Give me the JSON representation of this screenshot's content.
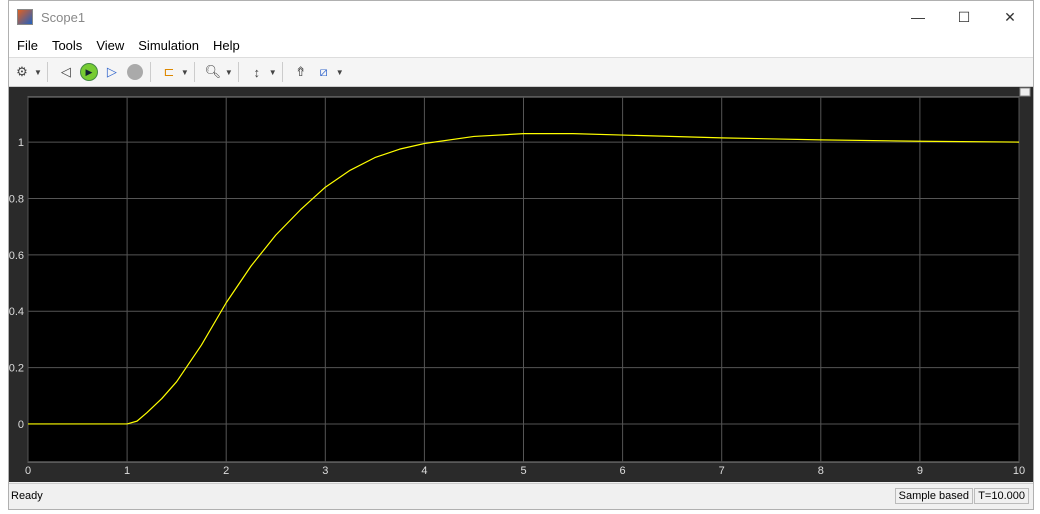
{
  "window": {
    "title": "Scope1",
    "minimize": "—",
    "maximize": "☐",
    "close": "✕"
  },
  "menu": [
    "File",
    "Tools",
    "View",
    "Simulation",
    "Help"
  ],
  "toolbar": {
    "icons": [
      "gear-icon",
      "step-back-icon",
      "run-icon",
      "step-forward-icon",
      "stop-icon",
      "signal-selector-icon",
      "zoom-icon",
      "scale-axes-icon",
      "triggers-icon",
      "measurements-icon"
    ]
  },
  "status": {
    "left": "Ready",
    "mode": "Sample based",
    "time": "T=10.000"
  },
  "colors": {
    "trace": "#ffff00",
    "axes_bg": "#000000",
    "grid": "#555555"
  },
  "chart_data": {
    "type": "line",
    "xlim": [
      0,
      10
    ],
    "ylim": [
      -0.135,
      1.16
    ],
    "xticks": [
      "0",
      "1",
      "2",
      "3",
      "4",
      "5",
      "6",
      "7",
      "8",
      "9",
      "10"
    ],
    "yticks": [
      "0",
      "0.2",
      "0.4",
      "0.6",
      "0.8",
      "1"
    ],
    "grid": true,
    "series": [
      {
        "color": "#ffff00",
        "x": [
          0,
          1,
          1.1,
          1.2,
          1.35,
          1.5,
          1.75,
          2,
          2.25,
          2.5,
          2.75,
          3,
          3.25,
          3.5,
          3.75,
          4,
          4.5,
          5,
          5.5,
          6,
          7,
          8,
          9,
          10
        ],
        "y": [
          0,
          0,
          0.01,
          0.04,
          0.09,
          0.15,
          0.28,
          0.43,
          0.56,
          0.67,
          0.76,
          0.84,
          0.9,
          0.945,
          0.975,
          0.995,
          1.02,
          1.03,
          1.03,
          1.025,
          1.015,
          1.008,
          1.003,
          1.0
        ]
      }
    ]
  }
}
